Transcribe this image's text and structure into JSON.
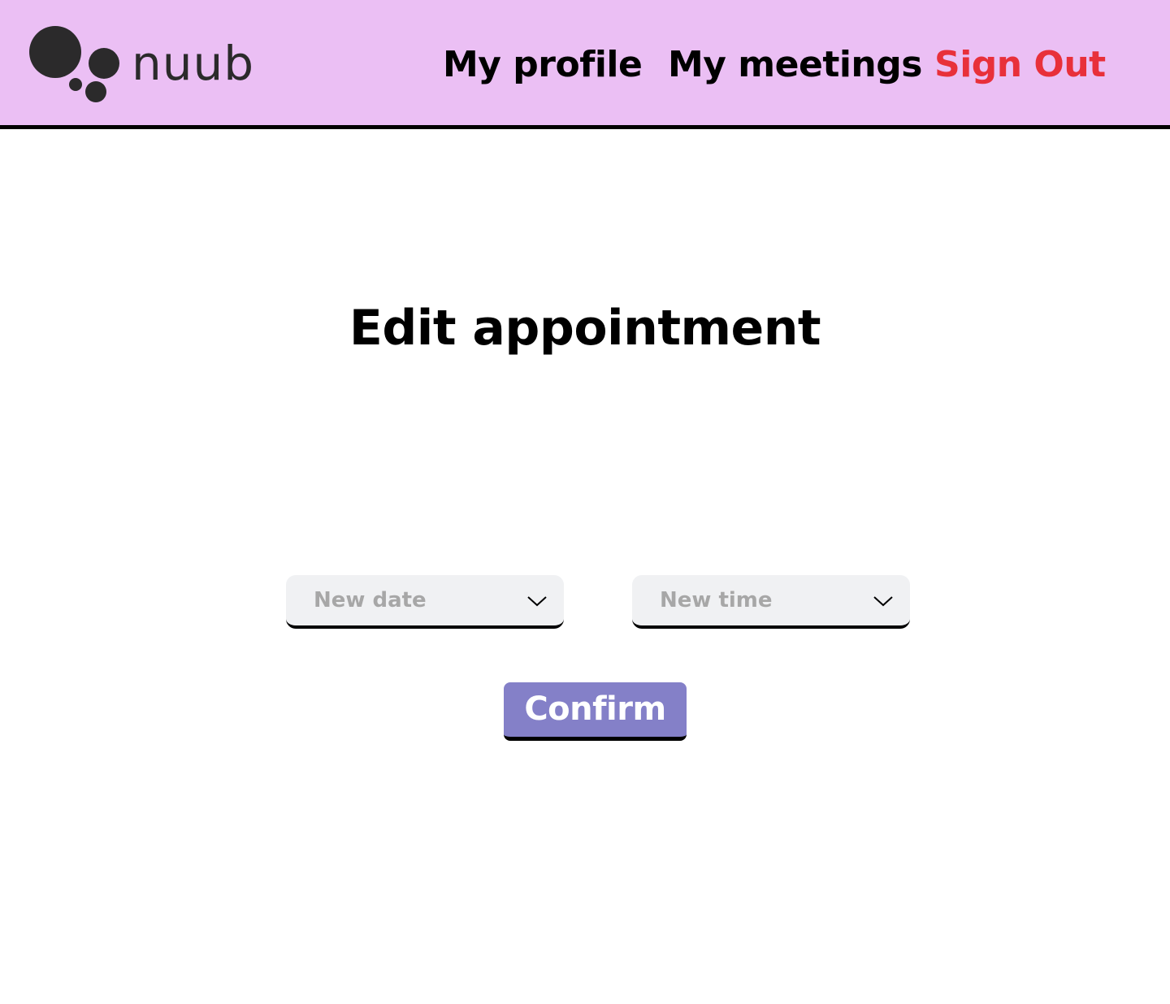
{
  "brand": {
    "name": "nuub",
    "logo_icon": "bubbles-logo-icon",
    "logo_color": "#2b2a2b"
  },
  "nav": {
    "my_profile": "My profile",
    "my_meetings": "My meetings",
    "sign_out": "Sign Out"
  },
  "main": {
    "title": "Edit appointment",
    "date_select": {
      "placeholder": "New date",
      "icon": "chevron-down-icon"
    },
    "time_select": {
      "placeholder": "New time",
      "icon": "chevron-down-icon"
    },
    "confirm_label": "Confirm"
  },
  "colors": {
    "header_background": "#ebbff4",
    "sign_out": "#e8303a",
    "confirm_button": "#8480c8",
    "select_background": "#f0f1f3",
    "placeholder_text": "#a7a7a7"
  }
}
